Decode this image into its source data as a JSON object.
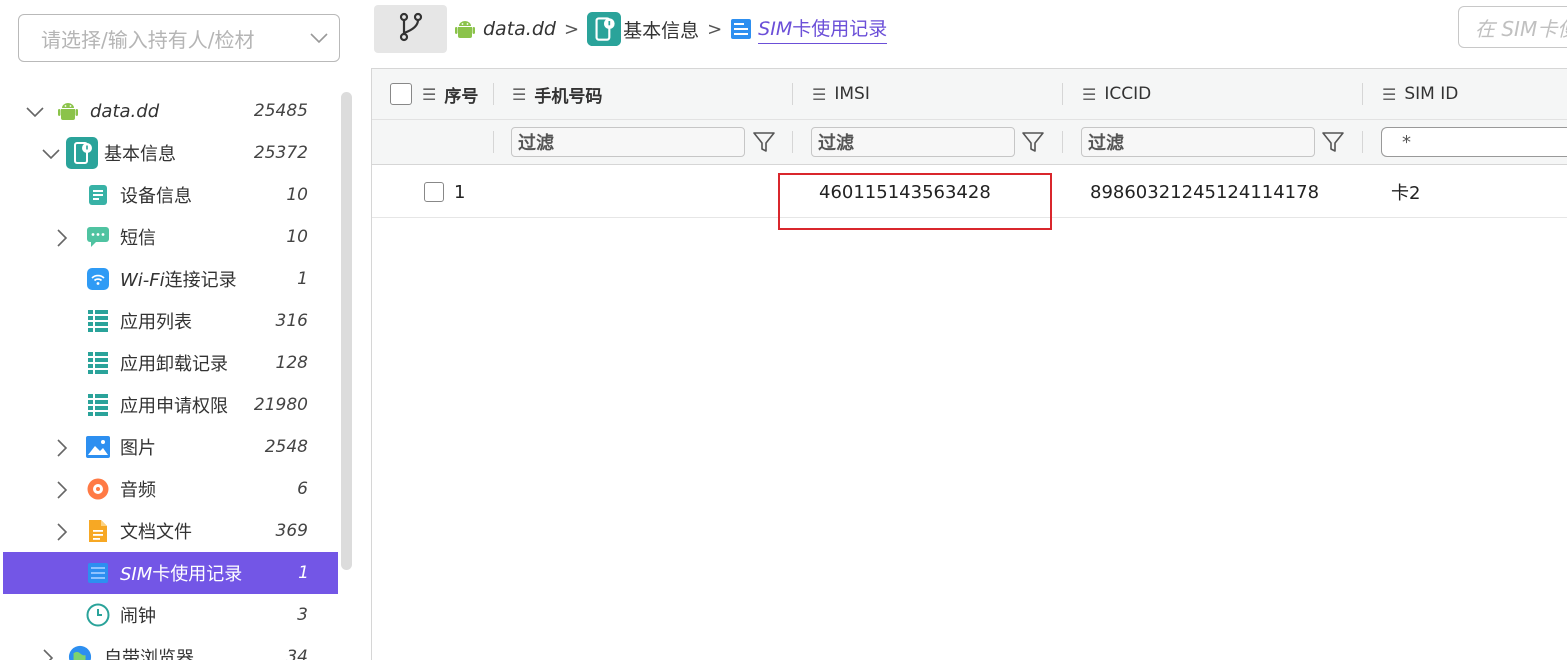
{
  "sidebar": {
    "owner_placeholder": "请选择/输入持有人/检材",
    "tree": [
      {
        "label": "data.dd",
        "count": "25485"
      },
      {
        "label": "基本信息",
        "count": "25372"
      },
      {
        "label": "设备信息",
        "count": "10"
      },
      {
        "label": "短信",
        "count": "10"
      },
      {
        "label": "Wi-Fi",
        "label2": "连接记录",
        "count": "1"
      },
      {
        "label": "应用列表",
        "count": "316"
      },
      {
        "label": "应用卸载记录",
        "count": "128"
      },
      {
        "label": "应用申请权限",
        "count": "21980"
      },
      {
        "label": "图片",
        "count": "2548"
      },
      {
        "label": "音频",
        "count": "6"
      },
      {
        "label": "文档文件",
        "count": "369"
      },
      {
        "label": "SIM",
        "label2": "卡使用记录",
        "count": "1"
      },
      {
        "label": "闹钟",
        "count": "3"
      },
      {
        "label": "自带浏览器",
        "count": "34"
      }
    ]
  },
  "breadcrumb": {
    "root": "data.dd",
    "level2": "基本信息",
    "current_a": "SIM",
    "current_b": "卡使用记录"
  },
  "search": {
    "placeholder": "在 SIM卡使用记录中搜索"
  },
  "grid": {
    "columns": [
      "序号",
      "手机号码",
      "IMSI",
      "ICCID",
      "SIM ID"
    ],
    "filter_placeholder": "过滤",
    "simid_filter": "*",
    "rows": [
      {
        "index": "1",
        "phone": "",
        "imsi": "460115143563428",
        "iccid": "89860321245124114178",
        "sim_id": "卡2"
      }
    ]
  },
  "colors": {
    "accent": "#7356e6",
    "highlight": "#d9262c",
    "teal": "#2aa39a"
  }
}
